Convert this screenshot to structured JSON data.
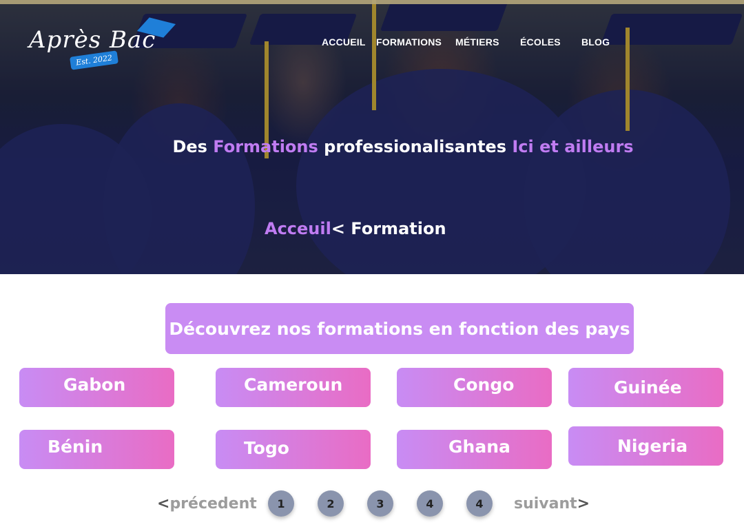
{
  "brand": {
    "name": "Après Bac",
    "badge": "Est. 2022",
    "color": "#1f7fd8"
  },
  "nav": [
    {
      "label": "ACCUEIL"
    },
    {
      "label": "FORMATIONS"
    },
    {
      "label": "MÉTIERS"
    },
    {
      "label": "ÉCOLES"
    },
    {
      "label": "BLOG"
    }
  ],
  "hero": {
    "tagline_1": "Des ",
    "tagline_2": "Formations",
    "tagline_3": " professionalisantes ",
    "tagline_4": "Ici et ailleurs",
    "breadcrumb_home": "Acceuil",
    "breadcrumb_sep": "< Formation",
    "accent": "#c07cf2"
  },
  "section": {
    "title": "Découvrez nos formations en fonction des pays"
  },
  "countries": [
    {
      "label": "Gabon"
    },
    {
      "label": "Cameroun"
    },
    {
      "label": "Congo"
    },
    {
      "label": "Guinée"
    },
    {
      "label": "Bénin"
    },
    {
      "label": "Togo"
    },
    {
      "label": "Ghana"
    },
    {
      "label": "Nigeria"
    }
  ],
  "pagination": {
    "prev_arrow": "<",
    "prev": "précedent",
    "pages": [
      "1",
      "2",
      "3",
      "4",
      "4"
    ],
    "next": "suivant",
    "next_arrow": ">"
  },
  "colors": {
    "button_start": "#c88cf4",
    "button_end": "#e96cc4",
    "title_bg": "#c98cf3",
    "page_bubble": "#8a94ad"
  }
}
